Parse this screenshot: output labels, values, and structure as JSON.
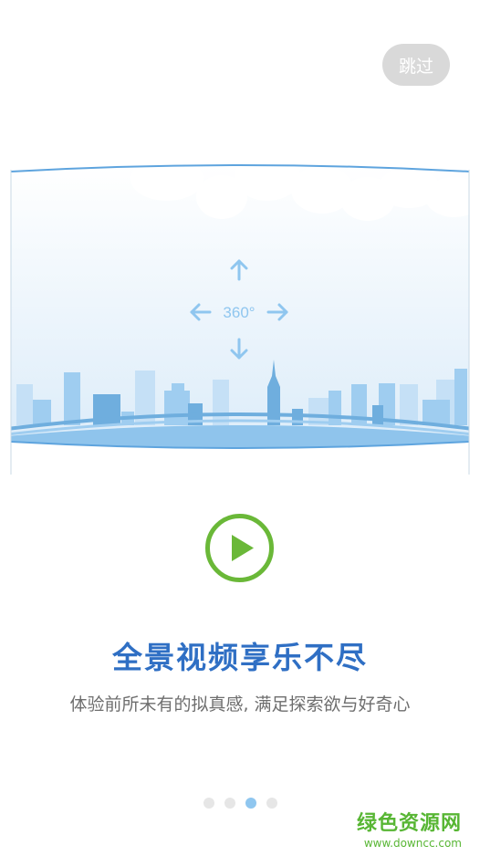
{
  "skip": {
    "label": "跳过"
  },
  "illustration": {
    "rotation_label": "360°"
  },
  "play": {
    "icon": "play-icon",
    "color": "#6ab838"
  },
  "onboarding": {
    "title": "全景视频享乐不尽",
    "subtitle": "体验前所未有的拟真感, 满足探索欲与好奇心"
  },
  "pagination": {
    "total": 4,
    "active_index": 2
  },
  "watermark": {
    "name": "绿色资源网",
    "url": "www.downcc.com"
  },
  "colors": {
    "accent_blue": "#2f6fc4",
    "dot_active": "#8fc6ef",
    "dot_inactive": "#e6e6e6",
    "skip_bg": "#d9d9d9",
    "watermark_green": "#58b634"
  }
}
